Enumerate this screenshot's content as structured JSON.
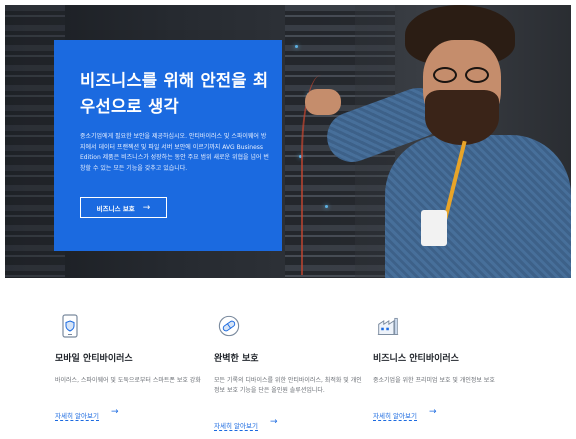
{
  "hero": {
    "title": "비즈니스를 위해 안전을 최우선으로 생각",
    "description": "중소기업에게 필요한 보안을 제공하십시오. 안티바이러스 및 스파이웨어 방지에서 데이터 프랜젝션 및 파일 서버 보안에 이르기까지 AVG Business Edition 제품은 비즈니스가 성장하는 동안 주요 범위 새로운 위협을 넘어 번창할 수 있는 모든 기능을 갖추고 있습니다.",
    "button_label": "비즈니스 보호",
    "button_arrow": "→",
    "card_color": "#1b6ae0"
  },
  "features": [
    {
      "icon": "mobile-shield-icon",
      "name": "모바일 안티바이러스",
      "description": "바이러스, 스파이웨어 및 도둑으로부터 스마트폰 보호 강화",
      "link": "자세히 알아보기",
      "link_arrow": "→"
    },
    {
      "icon": "pill-capsule-icon",
      "name": "완벽한 보호",
      "description": "모든 기록의 디바이스를 위한 안티바이러스, 최적화 및 개인정보 보호 기능을 단은 올인원 솔루션입니다.",
      "link": "자세히 알아보기",
      "link_arrow": "→"
    },
    {
      "icon": "factory-building-icon",
      "name": "비즈니스 안티바이러스",
      "description": "중소기업을 위한 프리미엄 보호 및 개인정보 보호",
      "link": "자세히 알아보기",
      "link_arrow": "→"
    }
  ],
  "link_color": "#1b6ae0"
}
